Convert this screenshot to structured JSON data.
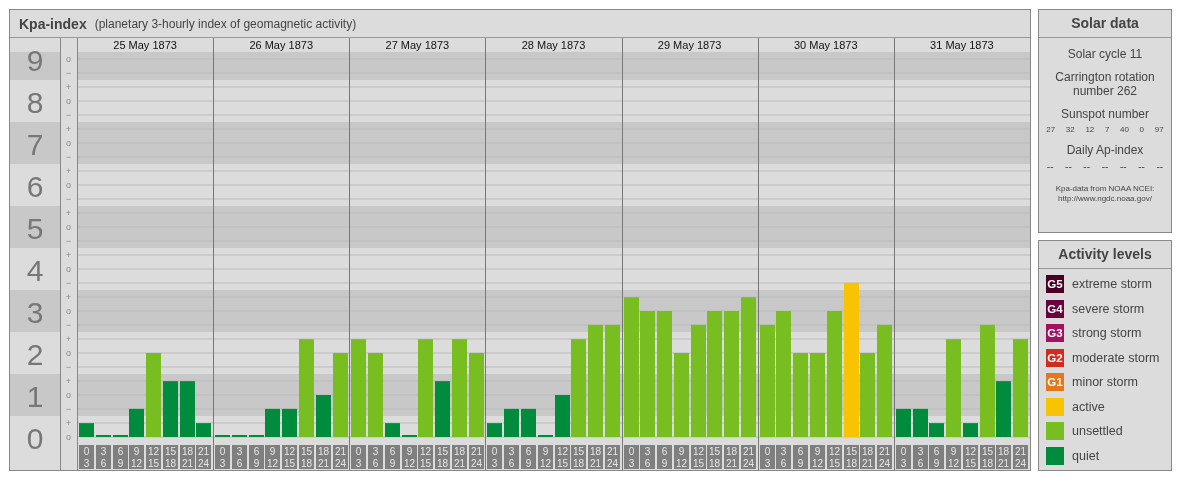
{
  "header": {
    "title": "Kpa-index",
    "subtitle": "(planetary 3-hourly index of geomagnetic activity)"
  },
  "chart": {
    "minor_labels": [
      "o",
      "−",
      "+",
      "o",
      "−",
      "+",
      "o",
      "−",
      "+",
      "o",
      "−",
      "+",
      "o",
      "−",
      "+",
      "o",
      "−",
      "+",
      "o",
      "−",
      "+",
      "o",
      "−",
      "+",
      "o",
      "−",
      "+",
      "o"
    ],
    "days": [
      {
        "date": "25 May 1873",
        "slots": [
          [
            "0",
            "3"
          ],
          [
            "3",
            "6"
          ],
          [
            "6",
            "9"
          ],
          [
            "9",
            "12"
          ],
          [
            "12",
            "15"
          ],
          [
            "15",
            "18"
          ],
          [
            "18",
            "21"
          ],
          [
            "21",
            "24"
          ]
        ]
      },
      {
        "date": "26 May 1873",
        "slots": [
          [
            "0",
            "3"
          ],
          [
            "3",
            "6"
          ],
          [
            "6",
            "9"
          ],
          [
            "9",
            "12"
          ],
          [
            "12",
            "15"
          ],
          [
            "15",
            "18"
          ],
          [
            "18",
            "21"
          ],
          [
            "21",
            "24"
          ]
        ]
      },
      {
        "date": "27 May 1873",
        "slots": [
          [
            "0",
            "3"
          ],
          [
            "3",
            "6"
          ],
          [
            "6",
            "9"
          ],
          [
            "9",
            "12"
          ],
          [
            "12",
            "15"
          ],
          [
            "15",
            "18"
          ],
          [
            "18",
            "21"
          ],
          [
            "21",
            "24"
          ]
        ]
      },
      {
        "date": "28 May 1873",
        "slots": [
          [
            "0",
            "3"
          ],
          [
            "3",
            "6"
          ],
          [
            "6",
            "9"
          ],
          [
            "9",
            "12"
          ],
          [
            "12",
            "15"
          ],
          [
            "15",
            "18"
          ],
          [
            "18",
            "21"
          ],
          [
            "21",
            "24"
          ]
        ]
      },
      {
        "date": "29 May 1873",
        "slots": [
          [
            "0",
            "3"
          ],
          [
            "3",
            "6"
          ],
          [
            "6",
            "9"
          ],
          [
            "9",
            "12"
          ],
          [
            "12",
            "15"
          ],
          [
            "15",
            "18"
          ],
          [
            "18",
            "21"
          ],
          [
            "21",
            "24"
          ]
        ]
      },
      {
        "date": "30 May 1873",
        "slots": [
          [
            "0",
            "3"
          ],
          [
            "3",
            "6"
          ],
          [
            "6",
            "9"
          ],
          [
            "9",
            "12"
          ],
          [
            "12",
            "15"
          ],
          [
            "15",
            "18"
          ],
          [
            "18",
            "21"
          ],
          [
            "21",
            "24"
          ]
        ]
      },
      {
        "date": "31 May 1873",
        "slots": [
          [
            "0",
            "3"
          ],
          [
            "3",
            "6"
          ],
          [
            "6",
            "9"
          ],
          [
            "9",
            "12"
          ],
          [
            "12",
            "15"
          ],
          [
            "15",
            "18"
          ],
          [
            "18",
            "21"
          ],
          [
            "21",
            "24"
          ]
        ]
      }
    ],
    "chart_data": {
      "type": "bar",
      "grid": true,
      "ylim": [
        0,
        9.5
      ],
      "yticks": [
        9,
        8,
        7,
        6,
        5,
        4,
        3,
        2,
        1,
        0
      ],
      "series": [
        {
          "name": "active",
          "color": "#f8c300",
          "values": [
            null,
            null,
            null,
            null,
            null,
            null,
            null,
            null,
            null,
            null,
            null,
            null,
            null,
            null,
            null,
            null,
            null,
            null,
            null,
            null,
            null,
            null,
            null,
            null,
            null,
            null,
            null,
            null,
            null,
            null,
            null,
            null,
            null,
            null,
            null,
            null,
            null,
            null,
            null,
            null,
            null,
            null,
            null,
            null,
            null,
            3.67,
            null,
            null,
            null,
            null,
            null,
            null,
            null,
            null,
            null,
            null
          ]
        },
        {
          "name": "unsettled",
          "color": "#78be20",
          "values": [
            null,
            null,
            null,
            null,
            2,
            null,
            null,
            null,
            null,
            null,
            null,
            null,
            null,
            2.33,
            null,
            2,
            2.33,
            2,
            null,
            null,
            2.33,
            null,
            2.33,
            2,
            null,
            null,
            null,
            null,
            null,
            2.33,
            2.67,
            2.67,
            3.33,
            3,
            3,
            2,
            2.67,
            3,
            3,
            3.33,
            2.67,
            3,
            2,
            2,
            3,
            null,
            2,
            2.67,
            null,
            null,
            null,
            2.33,
            null,
            2.67,
            null,
            2.33
          ]
        },
        {
          "name": "quiet",
          "color": "#008c3c",
          "values": [
            0.33,
            0,
            0,
            0.67,
            null,
            1.33,
            1.33,
            0.33,
            0,
            0,
            0,
            0.67,
            0.67,
            null,
            1,
            null,
            null,
            null,
            0.33,
            0,
            null,
            1.33,
            null,
            null,
            0.33,
            0.67,
            0.67,
            0,
            1,
            null,
            null,
            null,
            null,
            null,
            null,
            null,
            null,
            null,
            null,
            null,
            null,
            null,
            null,
            null,
            null,
            null,
            null,
            null,
            0.67,
            0.67,
            0.33,
            null,
            0.33,
            null,
            1.33,
            null
          ]
        }
      ]
    }
  },
  "solar": {
    "title": "Solar data",
    "cycle": "Solar cycle 11",
    "rotation": "Carrington rotation number 262",
    "sunspot_title": "Sunspot number",
    "sunspots": [
      "27",
      "32",
      "12",
      "7",
      "40",
      "0",
      "97"
    ],
    "ap_title": "Daily Ap-index",
    "ap_values": [
      "--",
      "--",
      "--",
      "--",
      "--",
      "--",
      "--"
    ],
    "source": "Kpa-data from NOAA NCEI:",
    "source_link": "http://www.ngdc.noaa.gov/"
  },
  "legend": {
    "title": "Activity levels",
    "items": [
      {
        "badge": "G5",
        "label": "extreme storm",
        "color": "#4a0026"
      },
      {
        "badge": "G4",
        "label": "severe storm",
        "color": "#6b0040"
      },
      {
        "badge": "G3",
        "label": "strong storm",
        "color": "#a3105e"
      },
      {
        "badge": "G2",
        "label": "moderate storm",
        "color": "#d42a1c"
      },
      {
        "badge": "G1",
        "label": "minor storm",
        "color": "#e5761a"
      }
    ]
  }
}
